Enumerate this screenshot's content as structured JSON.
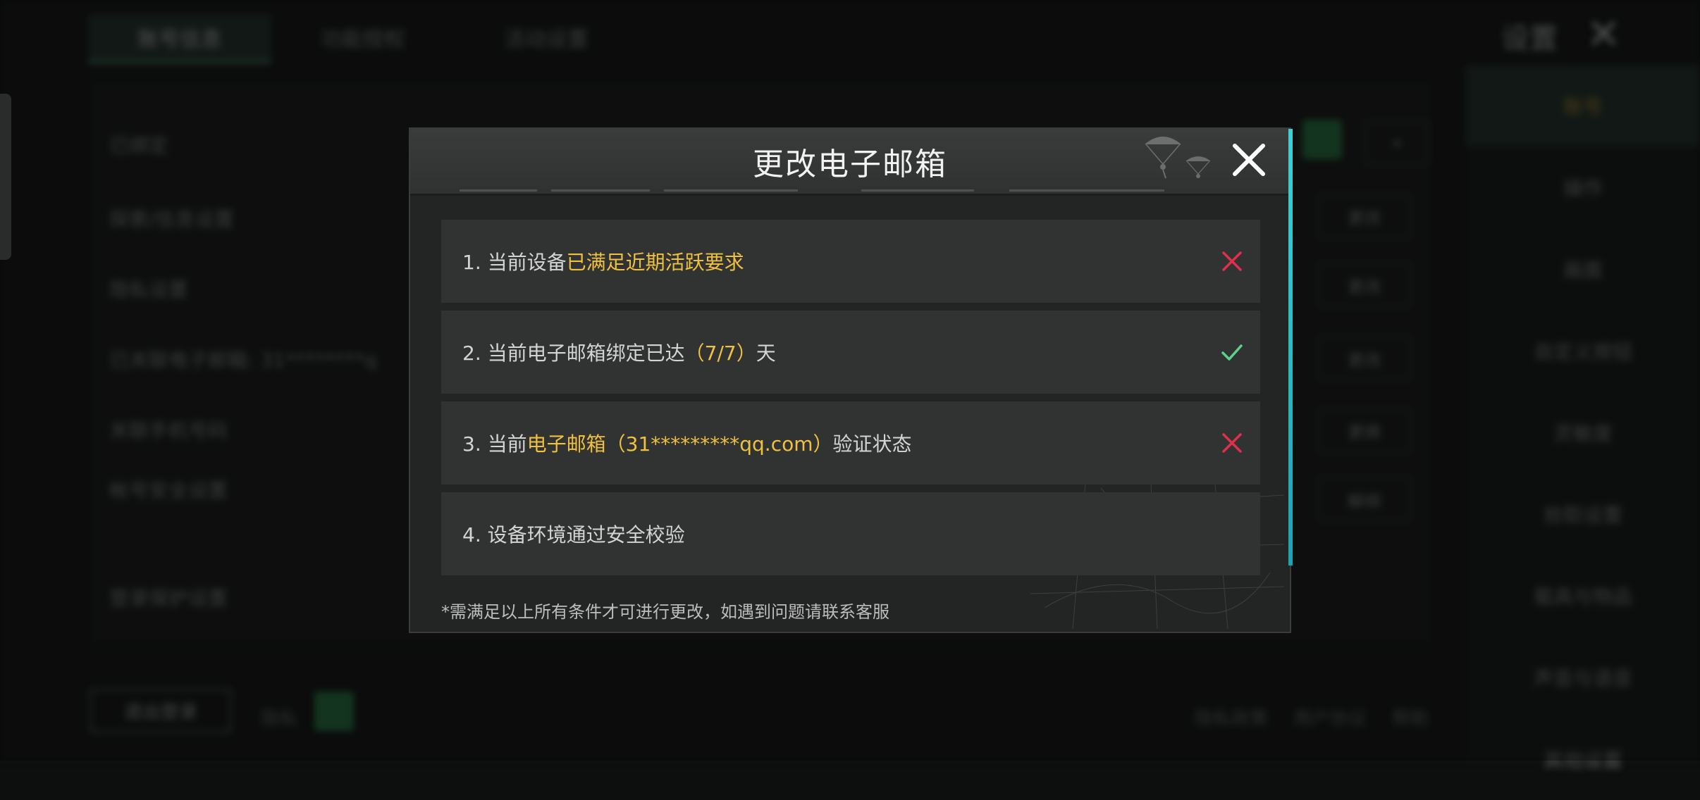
{
  "background": {
    "tabs": [
      "账号信息",
      "功能授权",
      "活动设置"
    ],
    "settings_title": "设置",
    "rows": [
      "已绑定",
      "探索/信息设置",
      "隐私设置",
      "已关联电子邮箱: 31********q",
      "关联手机号码",
      "帐号安全设置",
      "登录保护设置"
    ],
    "row_buttons": [
      "更改",
      "更改",
      "更改",
      "更换",
      "解绑"
    ],
    "sidebar": [
      "账号",
      "操作",
      "画面",
      "自定义按钮",
      "灵敏度",
      "拾取设置",
      "载具与物品",
      "声音与语音",
      "其他设置"
    ],
    "exit_button": "退出登录",
    "bottom_labels": [
      "隐私",
      "隐私政策",
      "用户协议",
      "帮助"
    ]
  },
  "modal": {
    "title": "更改电子邮箱",
    "requirements": [
      {
        "prefix": "1. 当前设备",
        "highlight": "已满足近期活跃要求",
        "suffix": "",
        "status": "fail"
      },
      {
        "prefix": "2. 当前电子邮箱绑定已达",
        "highlight": "（7/7）",
        "suffix": "天",
        "status": "pass"
      },
      {
        "prefix": "3. 当前",
        "highlight": "电子邮箱（31*********qq.com）",
        "suffix": "验证状态",
        "status": "fail"
      },
      {
        "prefix": "4. 设备环境通过安全校验",
        "highlight": "",
        "suffix": "",
        "status": "none"
      }
    ],
    "footnote": "*需满足以上所有条件才可进行更改，如遇到问题请联系客服"
  },
  "colors": {
    "highlight": "#f0c040",
    "fail": "#e0304a",
    "pass": "#5fd08a",
    "accent_edge": "#3fd0d6"
  },
  "icons": {
    "close": "close-icon",
    "fail": "cross-icon",
    "pass": "check-icon"
  }
}
